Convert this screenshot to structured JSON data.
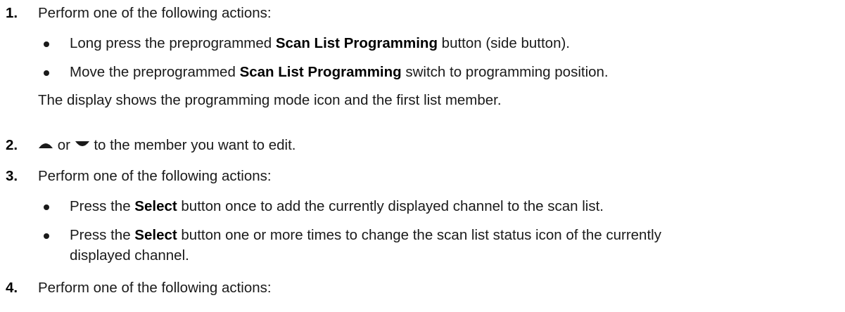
{
  "steps": [
    {
      "number": "1.",
      "text": "Perform one of the following actions:",
      "bullets": [
        {
          "before": "Long press the preprogrammed ",
          "bold": "Scan List Programming",
          "after": " button (side button)."
        },
        {
          "before": "Move the preprogrammed ",
          "bold": "Scan List Programming",
          "after": " switch to programming position."
        }
      ],
      "note": "The display shows the programming mode icon and the first list member."
    },
    {
      "number": "2.",
      "or_word": "or",
      "text_after": "to the member you want to edit.",
      "icons": [
        "up-arrow-icon",
        "down-arrow-icon"
      ]
    },
    {
      "number": "3.",
      "text": "Perform one of the following actions:",
      "bullets": [
        {
          "before": "Press the ",
          "bold": "Select",
          "after": " button once to add the currently displayed channel to the scan list."
        },
        {
          "before": "Press the ",
          "bold": "Select",
          "after": " button one or more times to change the scan list status icon of the currently",
          "continuation": "displayed channel."
        }
      ]
    },
    {
      "number": "4.",
      "text": "Perform one of the following actions:"
    }
  ]
}
